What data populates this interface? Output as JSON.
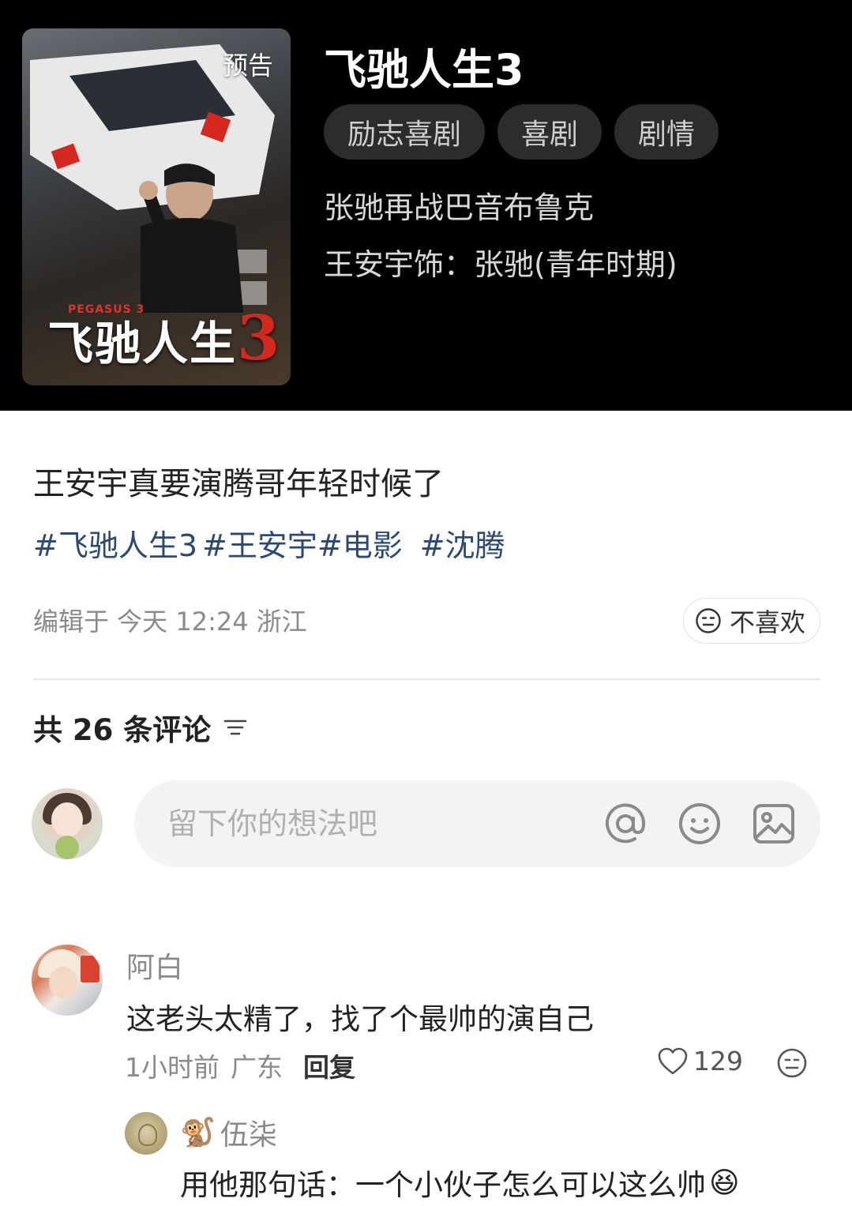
{
  "movie": {
    "badge": "预告",
    "poster_subtitle": "PEGASUS 3",
    "poster_logo": "飞驰人生",
    "poster_logo_num": "3",
    "title": "飞驰人生3",
    "tags": [
      "励志喜剧",
      "喜剧",
      "剧情"
    ],
    "description": "张驰再战巴音布鲁克",
    "role": "王安宇饰：张驰(青年时期)"
  },
  "post": {
    "text": "王安宇真要演腾哥年轻时候了",
    "hashtags": [
      "#飞驰人生3",
      "#王安宇",
      "#电影",
      "#沈腾"
    ],
    "meta": "编辑于 今天 12:24 浙江",
    "dislike_label": "不喜欢"
  },
  "comments_header": {
    "count_label": "共 26 条评论"
  },
  "comment_input": {
    "placeholder": "留下你的想法吧"
  },
  "comments": [
    {
      "name": "阿白",
      "text": "这老头太精了，找了个最帅的演自己",
      "time": "1小时前",
      "location": "广东",
      "reply_label": "回复",
      "likes": "129",
      "replies": [
        {
          "name_emoji": "🐒",
          "name": "伍柒",
          "text": "用他那句话：一个小伙子怎么可以这么帅",
          "text_emoji": "😆"
        }
      ]
    }
  ],
  "colors": {
    "hashtag": "#2b4a73",
    "movie_card_bg": "#000000",
    "tag_bg": "#2c2c2c",
    "input_bg": "#f3f3f3",
    "accent_red": "#d4281e"
  }
}
